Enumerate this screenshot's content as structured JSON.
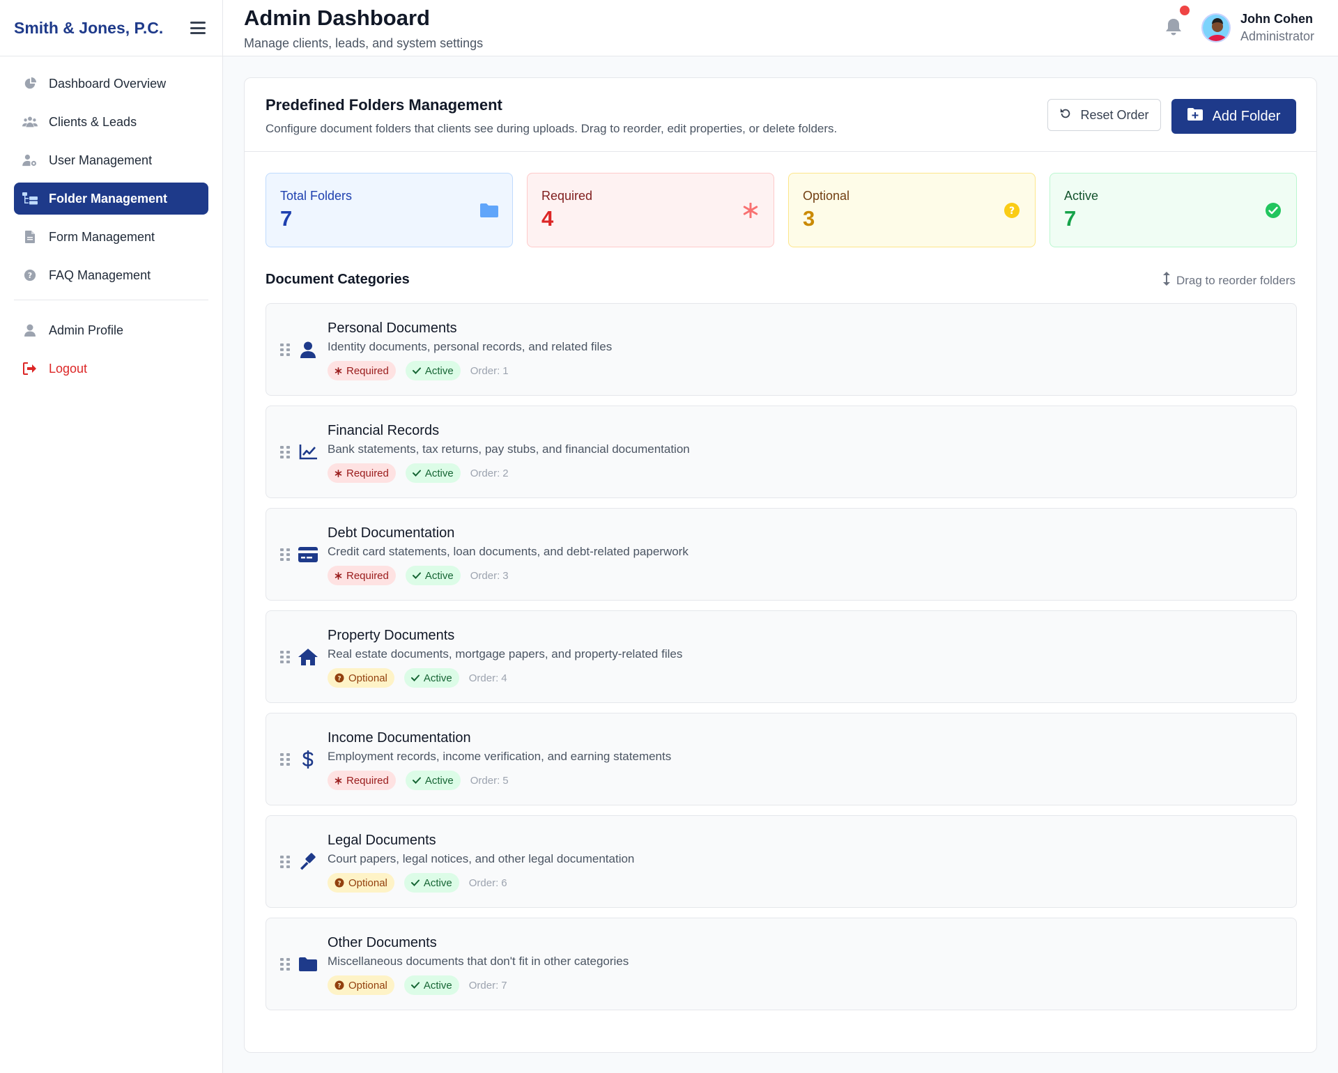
{
  "sidebar": {
    "brand": "Smith & Jones, P.C.",
    "items": [
      {
        "label": "Dashboard Overview",
        "icon": "pie-chart-icon"
      },
      {
        "label": "Clients & Leads",
        "icon": "users-icon"
      },
      {
        "label": "User Management",
        "icon": "user-gear-icon"
      },
      {
        "label": "Folder Management",
        "icon": "folder-tree-icon",
        "active": true
      },
      {
        "label": "Form Management",
        "icon": "file-icon"
      },
      {
        "label": "FAQ Management",
        "icon": "question-circle-icon"
      }
    ],
    "secondary": [
      {
        "label": "Admin Profile",
        "icon": "user-icon"
      },
      {
        "label": "Logout",
        "icon": "logout-icon"
      }
    ]
  },
  "header": {
    "title": "Admin Dashboard",
    "subtitle": "Manage clients, leads, and system settings",
    "user": {
      "name": "John Cohen",
      "role": "Administrator"
    }
  },
  "card": {
    "title": "Predefined Folders Management",
    "description": "Configure document folders that clients see during uploads. Drag to reorder, edit properties, or delete folders.",
    "reset_label": "Reset Order",
    "add_label": "Add Folder"
  },
  "stats": [
    {
      "label": "Total Folders",
      "value": "7",
      "icon": "folder-icon"
    },
    {
      "label": "Required",
      "value": "4",
      "icon": "asterisk-icon"
    },
    {
      "label": "Optional",
      "value": "3",
      "icon": "question-circle-icon"
    },
    {
      "label": "Active",
      "value": "7",
      "icon": "check-circle-icon"
    }
  ],
  "section": {
    "title": "Document Categories",
    "hint": "Drag to reorder folders"
  },
  "order_prefix": "Order:",
  "folders": [
    {
      "name": "Personal Documents",
      "description": "Identity documents, personal records, and related files",
      "requirement": "Required",
      "status": "Active",
      "order": "1",
      "icon": "user-icon"
    },
    {
      "name": "Financial Records",
      "description": "Bank statements, tax returns, pay stubs, and financial documentation",
      "requirement": "Required",
      "status": "Active",
      "order": "2",
      "icon": "chart-line-icon"
    },
    {
      "name": "Debt Documentation",
      "description": "Credit card statements, loan documents, and debt-related paperwork",
      "requirement": "Required",
      "status": "Active",
      "order": "3",
      "icon": "credit-card-icon"
    },
    {
      "name": "Property Documents",
      "description": "Real estate documents, mortgage papers, and property-related files",
      "requirement": "Optional",
      "status": "Active",
      "order": "4",
      "icon": "home-icon"
    },
    {
      "name": "Income Documentation",
      "description": "Employment records, income verification, and earning statements",
      "requirement": "Required",
      "status": "Active",
      "order": "5",
      "icon": "dollar-icon"
    },
    {
      "name": "Legal Documents",
      "description": "Court papers, legal notices, and other legal documentation",
      "requirement": "Optional",
      "status": "Active",
      "order": "6",
      "icon": "gavel-icon"
    },
    {
      "name": "Other Documents",
      "description": "Miscellaneous documents that don't fit in other categories",
      "requirement": "Optional",
      "status": "Active",
      "order": "7",
      "icon": "folder-icon"
    }
  ],
  "colors": {
    "primary": "#1e3a8a",
    "danger": "#dc2626",
    "warning": "#ca8a04",
    "success": "#16a34a"
  }
}
